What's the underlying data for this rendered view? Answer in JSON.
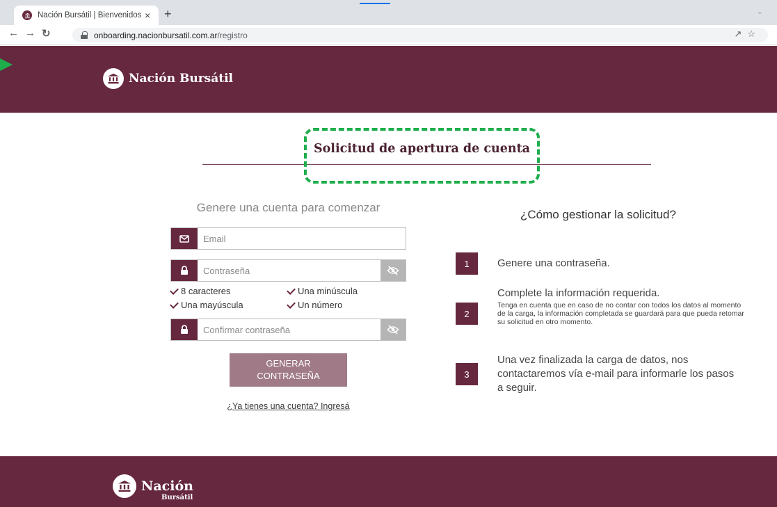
{
  "browser": {
    "tab_title": "Nación Bursátil | Bienvenidos",
    "tab_close": "×",
    "new_tab": "+",
    "url_domain": "onboarding.nacionbursatil.com.ar",
    "url_path": "/registro"
  },
  "header": {
    "brand": "Nación Bursátil"
  },
  "page": {
    "title": "Solicitud de apertura de cuenta"
  },
  "form": {
    "heading": "Genere una cuenta para comenzar",
    "email_placeholder": "Email",
    "password_placeholder": "Contraseña",
    "confirm_placeholder": "Confirmar contraseña",
    "requirements": [
      "8 caracteres",
      "Una minúscula",
      "Una mayúscula",
      "Un número"
    ],
    "generate_button": "GENERAR CONTRASEÑA",
    "login_link": "¿Ya tienes una cuenta? Ingresá"
  },
  "steps": {
    "heading": "¿Cómo gestionar la solicitud?",
    "items": [
      {
        "number": "1",
        "text": "Genere una contraseña.",
        "note": ""
      },
      {
        "number": "2",
        "text": "Complete la información requerida.",
        "note": "Tenga en cuenta que en caso de no contar con todos los datos al momento de la carga, la información completada se guardará para que pueda retomar su solicitud en otro momento."
      },
      {
        "number": "3",
        "text": "Una vez finalizada la carga de datos, nos contactaremos vía e-mail para informarle los pasos a seguir.",
        "note": ""
      }
    ]
  },
  "footer": {
    "brand_line1": "Nación",
    "brand_line2": "Bursátil"
  },
  "colors": {
    "brand": "#66283f",
    "button": "#a07a87",
    "annotation": "#1fae4c"
  }
}
